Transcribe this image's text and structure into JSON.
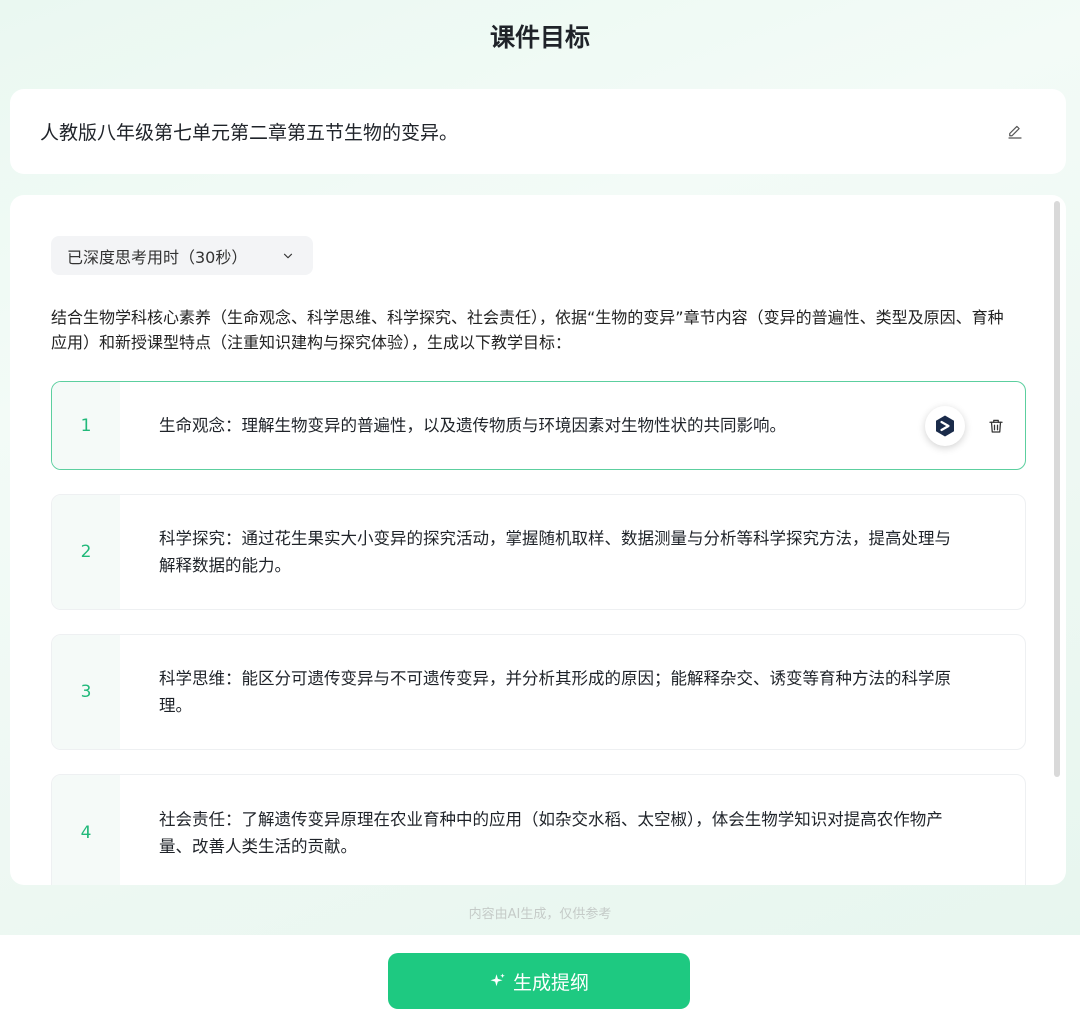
{
  "page": {
    "title": "课件目标"
  },
  "topic": {
    "text": "人教版八年级第七单元第二章第五节生物的变异。"
  },
  "thinking": {
    "label": "已深度思考用时（30秒）"
  },
  "intro": "结合生物学科核心素养（生命观念、科学思维、科学探究、社会责任），依据“生物的变异”章节内容（变异的普遍性、类型及原因、育种应用）和新授课型特点（注重知识建构与探究体验），生成以下教学目标：",
  "goals": [
    {
      "num": "1",
      "text": "生命观念：理解生物变异的普遍性，以及遗传物质与环境因素对生物性状的共同影响。"
    },
    {
      "num": "2",
      "text": "科学探究：通过花生果实大小变异的探究活动，掌握随机取样、数据测量与分析等科学探究方法，提高处理与解释数据的能力。"
    },
    {
      "num": "3",
      "text": "科学思维：能区分可遗传变异与不可遗传变异，并分析其形成的原因；能解释杂交、诱变等育种方法的科学原理。"
    },
    {
      "num": "4",
      "text": "社会责任：了解遗传变异原理在农业育种中的应用（如杂交水稻、太空椒），体会生物学知识对提高农作物产量、改善人类生活的贡献。"
    }
  ],
  "footer": {
    "disclaimer": "内容由AI生成，仅供参考",
    "generate_label": "生成提纲"
  },
  "colors": {
    "accent": "#1ec981",
    "number": "#21b97a",
    "active_border": "#5ccf9f"
  },
  "icons": {
    "edit": "pencil-icon",
    "chevron": "chevron-down-icon",
    "ai": "deepseek-logo-icon",
    "delete": "trash-icon",
    "sparkle": "sparkle-icon"
  }
}
